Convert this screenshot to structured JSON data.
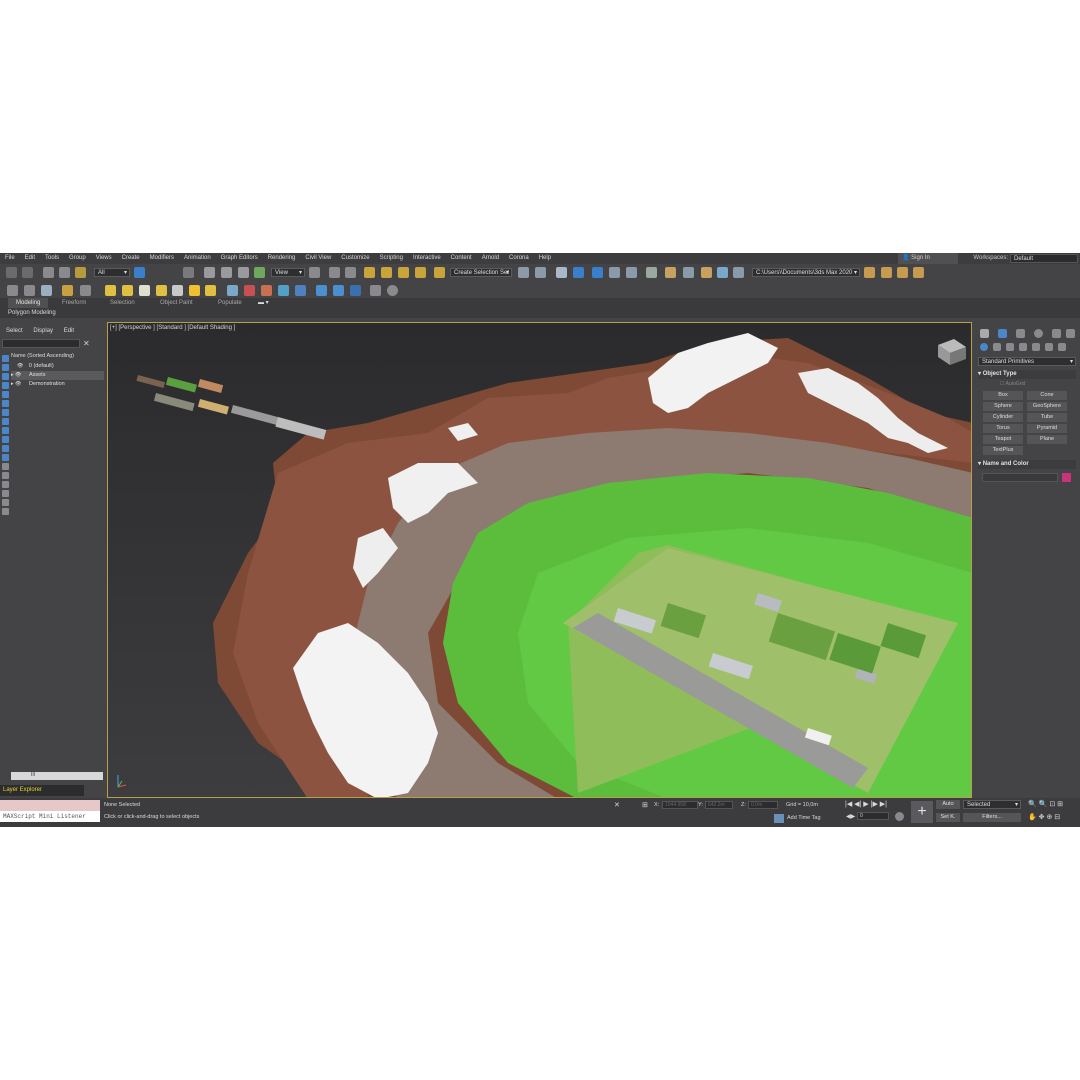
{
  "menu": [
    "File",
    "Edit",
    "Tools",
    "Group",
    "Views",
    "Create",
    "Modifiers",
    "Animation",
    "Graph Editors",
    "Rendering",
    "Civil View",
    "Customize",
    "Scripting",
    "Interactive",
    "Content",
    "Arnold",
    "Corona",
    "Help"
  ],
  "account": {
    "sign_in": "Sign In",
    "workspaces_label": "Workspaces:",
    "workspace_value": "Default"
  },
  "toolbar": {
    "filter_value": "All",
    "view_value": "View",
    "selection_set": "Create Selection Set",
    "project_path": "C:\\Users\\\\Documents\\3ds Max 2020"
  },
  "ribbon": {
    "tabs": [
      "Modeling",
      "Freeform",
      "Selection",
      "Object Paint",
      "Populate"
    ],
    "sub_label": "Polygon Modeling"
  },
  "explorer": {
    "tabs": [
      "Select",
      "Display",
      "Edit"
    ],
    "header": "Name (Sorted Ascending)",
    "rows": [
      "0 (default)",
      "Assets",
      "Demonstration"
    ],
    "scroll_text": "III"
  },
  "viewport": {
    "label": "[+] [Perspective ] [Standard ] [Default Shading ]"
  },
  "command_panel": {
    "dropdown": "Standard Primitives",
    "object_type": "Object Type",
    "autogrid": "AutoGrid",
    "buttons": [
      "Box",
      "Cone",
      "Sphere",
      "GeoSphere",
      "Cylinder",
      "Tube",
      "Torus",
      "Pyramid",
      "Teapot",
      "Plane",
      "TextPlus"
    ],
    "name_and_color": "Name and Color",
    "color": "#c8337a"
  },
  "status": {
    "layer_explorer": "Layer Explorer",
    "maxscript": "MAXScript Mini Listener",
    "none_selected": "None Selected",
    "prompt": "Click or click-and-drag to select objects",
    "x_label": "X:",
    "x_value": "1044.958",
    "y_label": "Y:",
    "y_value": "642.2m",
    "z_label": "Z:",
    "z_value": "0.0m",
    "grid": "Grid = 10,0m",
    "add_time_tag": "Add Time Tag",
    "frame": "0",
    "auto": "Auto",
    "selected": "Selected",
    "set_k": "Set K.",
    "filters": "Filters..."
  }
}
